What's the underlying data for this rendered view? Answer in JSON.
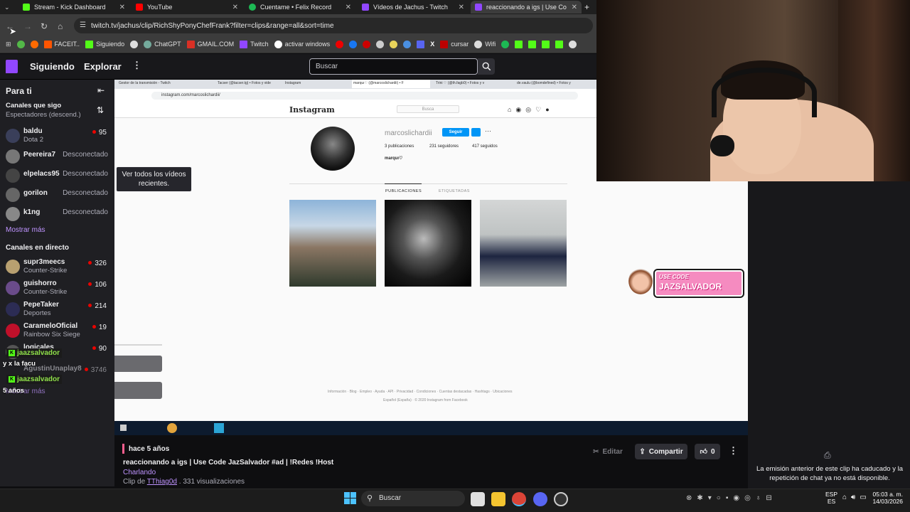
{
  "browser": {
    "tabs": [
      {
        "label": "Stream - Kick Dashboard",
        "color": "#53fc18"
      },
      {
        "label": "YouTube",
        "color": "#ff0000"
      },
      {
        "label": "Cuentame • Felix Record",
        "color": "#1db954"
      },
      {
        "label": "Vídeos de Jachus - Twitch",
        "color": "#9147ff"
      },
      {
        "label": "reaccionando a igs | Use Co",
        "color": "#9147ff"
      }
    ],
    "url": "twitch.tv/jachus/clip/RichShyPonyChefFrank?filter=clips&range=all&sort=time",
    "bookmarks": [
      "FACEIT..",
      "Siguiendo",
      "ChatGPT",
      "GMAIL.COM",
      "Twitch",
      "activar windows",
      "cursar",
      "Wifi"
    ]
  },
  "twitch": {
    "nav": {
      "following": "Siguiendo",
      "browse": "Explorar",
      "search_placeholder": "Buscar"
    },
    "sidebar": {
      "header": "Para ti",
      "followed_title": "Canales que sigo",
      "followed_sort": "Espectadores (descend.)",
      "followed": [
        {
          "name": "baldu",
          "game": "Dota 2",
          "viewers": "95",
          "avatar": "#3a3f5a"
        },
        {
          "name": "Peereira7",
          "status": "Desconectado",
          "avatar": "#777"
        },
        {
          "name": "elpelacs95",
          "status": "Desconectado",
          "avatar": "#444"
        },
        {
          "name": "gorilon",
          "status": "Desconectado",
          "avatar": "#666"
        },
        {
          "name": "k1ng",
          "status": "Desconectado",
          "avatar": "#888"
        }
      ],
      "show_more": "Mostrar más",
      "live_title": "Canales en directo",
      "live": [
        {
          "name": "supr3meecs",
          "game": "Counter-Strike",
          "viewers": "326",
          "avatar": "#b8a070"
        },
        {
          "name": "guishorro",
          "game": "Counter-Strike",
          "viewers": "106",
          "avatar": "#6a4b8a"
        },
        {
          "name": "PepeTaker",
          "game": "Deportes",
          "viewers": "214",
          "avatar": "#2c2c54"
        },
        {
          "name": "CarameloOficial",
          "game": "Rainbow Six Siege",
          "viewers": "19",
          "avatar": "#c0102a"
        },
        {
          "name": "logicales",
          "game": "",
          "viewers": "90",
          "avatar": "#555"
        },
        {
          "name": "AgustinUnaplay8",
          "game": "",
          "viewers": "3746",
          "avatar": "#555"
        }
      ],
      "show_more_2": "Mostrar más"
    },
    "tooltip": "Ver todos los vídeos recientes.",
    "clip": {
      "age": "hace 5 años",
      "title": "reaccionando a igs | Use Code JazSalvador #ad | !Redes !Host",
      "category": "Charlando",
      "clip_by_prefix": "Clip de",
      "clipper": "TThiag0d",
      "views": " . 331 visualizaciones",
      "edit": "Editar",
      "share": "Compartir",
      "likes": "0"
    },
    "chat_unavailable": "La emisión anterior de este clip ha caducado y la repetición de chat ya no está disponible."
  },
  "instagram": {
    "logo": "Instagram",
    "search": "Busca",
    "username": "marcoslichardii",
    "follow": "Seguir",
    "stats": [
      "3 publicaciones",
      "231 seguidores",
      "417 seguidos"
    ],
    "bio": "marquı♡",
    "tab_posts": "PUBLICACIONES",
    "tab_tagged": "ETIQUETADAS",
    "inner_url": "instagram.com/marcoslichardii/",
    "footer": "Información · Blog · Empleo · Ayuda · API · Privacidad · Condiciones · Cuentas destacadas · Hashtags · Ubicaciones",
    "footer2": "Español (España) · © 2020 Instagram from Facebook",
    "inner_tabs": [
      "Gestor de la transmisión - Twitch",
      "Tacser (@tacser.tg) • Fotos y vide",
      "Instagram",
      "marquı♡ (@marcoslichardii) • F",
      "Trini ♡ (@th.fagb0) • Fotos y v",
      "de.vaulu (@bomdefined) • Fotos y"
    ]
  },
  "overlay": {
    "promo_small": "USE CODE",
    "promo": "JAZSALVADOR",
    "chat": [
      {
        "user": "jaazsalvador",
        "msg": "y x la facu"
      },
      {
        "user": "jaazsalvador",
        "msg": "5 años"
      }
    ]
  },
  "taskbar": {
    "search": "Buscar",
    "lang": "ESP",
    "lang2": "ES",
    "time": "05:03 a. m.",
    "date": "14/03/2026"
  }
}
